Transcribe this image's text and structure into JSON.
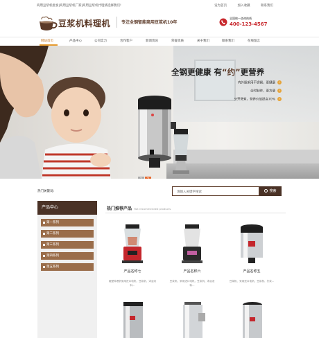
{
  "topbar": {
    "site_desc": "商用豆浆机批发|商用豆浆机厂家|商用豆浆机代理请选择我们!",
    "links": [
      "设为首页",
      "加入收藏",
      "联系我们"
    ]
  },
  "header": {
    "logo_text": "豆浆机料理机",
    "slogan": "专注全钢智能商用豆浆机10年",
    "hotline_label": "全国统一咨询热线",
    "hotline_number": "400-123-4567"
  },
  "nav": {
    "items": [
      "网站首页",
      "产品中心",
      "公司实力",
      "合作客户",
      "新闻资讯",
      "荣誉资质",
      "关于我们",
      "联系我们",
      "在线留言"
    ],
    "active_index": 0
  },
  "banner": {
    "headline_part1": "全钢更健康 有",
    "headline_highlight": "“约”",
    "headline_part2": "更营养",
    "features": [
      "内外胆采用不锈钢，更健康",
      "全时制作，更方便",
      "分开煲煮，营养价值提高70%"
    ],
    "pager": [
      "1",
      "2"
    ],
    "active_page": 1
  },
  "search": {
    "hot_label": "热门关键词：",
    "placeholder": "请输入关键字搜索",
    "button_label": "搜索"
  },
  "sidebar": {
    "title": "产品中心",
    "items": [
      "第一系列",
      "第二系列",
      "第三系列",
      "第四系列",
      "第五系列"
    ]
  },
  "products": {
    "title": "热门推荐产品",
    "title_en": "Hot recommended products",
    "items": [
      {
        "name": "产品名称七",
        "desc": "破壁料理机采用进口电机，豆浆机、沐浴浓料..."
      },
      {
        "name": "产品名称六",
        "desc": "豆浆机、采用进口电机，豆浆机、沐浴浓料..."
      },
      {
        "name": "产品名称五",
        "desc": "豆浆机、采用进口电机，豆浆机、打浆..."
      }
    ]
  },
  "colors": {
    "brand_brown": "#5c3a28",
    "dark_brown": "#4a3226",
    "accent_orange": "#e69a2e",
    "hotline_red": "#c8282d"
  }
}
